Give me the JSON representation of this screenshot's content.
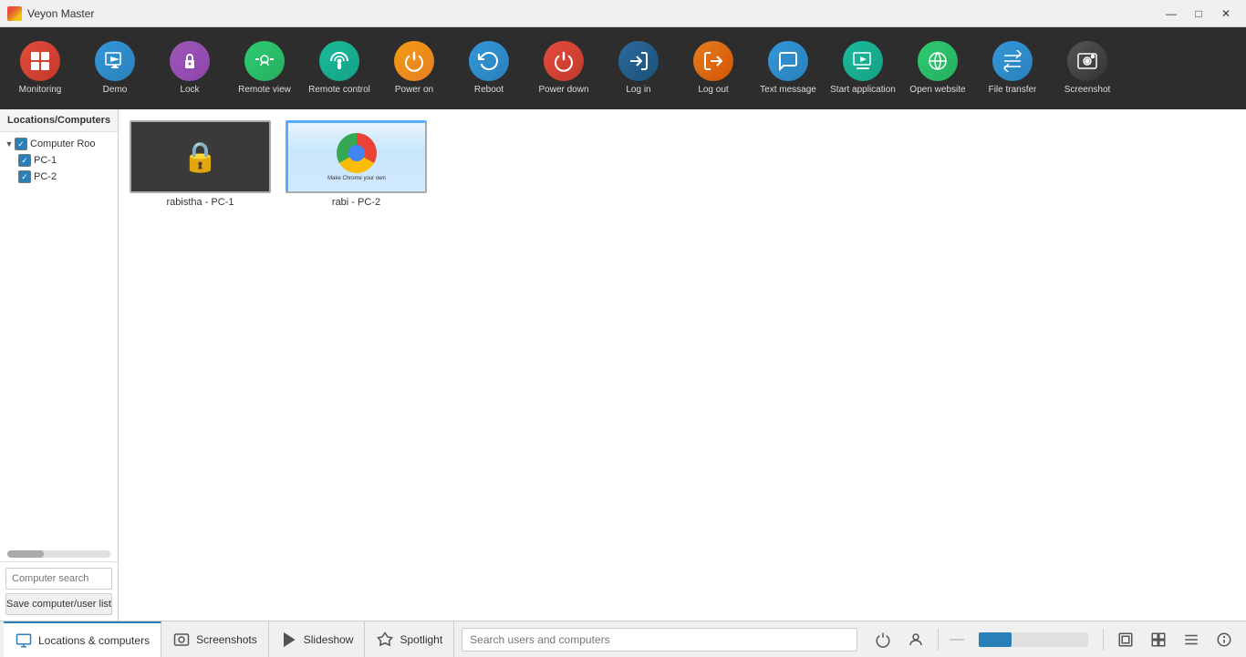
{
  "app": {
    "title": "Veyon Master"
  },
  "titlebar": {
    "minimize_label": "—",
    "maximize_label": "□",
    "close_label": "✕"
  },
  "toolbar": {
    "items": [
      {
        "id": "monitoring",
        "label": "Monitoring",
        "icon": "⊞",
        "icon_class": "icon-monitoring"
      },
      {
        "id": "demo",
        "label": "Demo",
        "icon": "▶",
        "icon_class": "icon-demo"
      },
      {
        "id": "lock",
        "label": "Lock",
        "icon": "🔒",
        "icon_class": "icon-lock"
      },
      {
        "id": "remote-view",
        "label": "Remote view",
        "icon": "👁",
        "icon_class": "icon-remote-view"
      },
      {
        "id": "remote-control",
        "label": "Remote control",
        "icon": "📡",
        "icon_class": "icon-remote-control"
      },
      {
        "id": "power-on",
        "label": "Power on",
        "icon": "⚡",
        "icon_class": "icon-power-on"
      },
      {
        "id": "reboot",
        "label": "Reboot",
        "icon": "↺",
        "icon_class": "icon-reboot"
      },
      {
        "id": "power-down",
        "label": "Power down",
        "icon": "⏻",
        "icon_class": "icon-power-down"
      },
      {
        "id": "log-in",
        "label": "Log in",
        "icon": "→",
        "icon_class": "icon-log-in"
      },
      {
        "id": "log-out",
        "label": "Log out",
        "icon": "←",
        "icon_class": "icon-log-out"
      },
      {
        "id": "text-message",
        "label": "Text message",
        "icon": "✉",
        "icon_class": "icon-text-message"
      },
      {
        "id": "start-app",
        "label": "Start application",
        "icon": "▶",
        "icon_class": "icon-start-app"
      },
      {
        "id": "open-website",
        "label": "Open website",
        "icon": "🌐",
        "icon_class": "icon-open-website"
      },
      {
        "id": "file-transfer",
        "label": "File transfer",
        "icon": "📁",
        "icon_class": "icon-file-transfer"
      },
      {
        "id": "screenshot",
        "label": "Screenshot",
        "icon": "📷",
        "icon_class": "icon-screenshot"
      }
    ]
  },
  "sidebar": {
    "header": "Locations/Computers",
    "tree": {
      "root": "Computer Roo",
      "children": [
        "PC-1",
        "PC-2"
      ]
    },
    "search_placeholder": "Computer search",
    "save_button_label": "Save computer/user list"
  },
  "computers": [
    {
      "id": "pc1",
      "name": "rabistha - PC-1",
      "locked": true,
      "has_screenshot": false
    },
    {
      "id": "pc2",
      "name": "rabi - PC-2",
      "locked": false,
      "has_screenshot": true
    }
  ],
  "bottombar": {
    "tabs": [
      {
        "id": "locations",
        "label": "Locations & computers",
        "icon": "🖥"
      },
      {
        "id": "screenshots",
        "label": "Screenshots",
        "icon": "📷"
      },
      {
        "id": "slideshow",
        "label": "Slideshow",
        "icon": "▶"
      },
      {
        "id": "spotlight",
        "label": "Spotlight",
        "icon": "🔦"
      }
    ],
    "search_placeholder": "Search users and computers",
    "progress": 30
  }
}
